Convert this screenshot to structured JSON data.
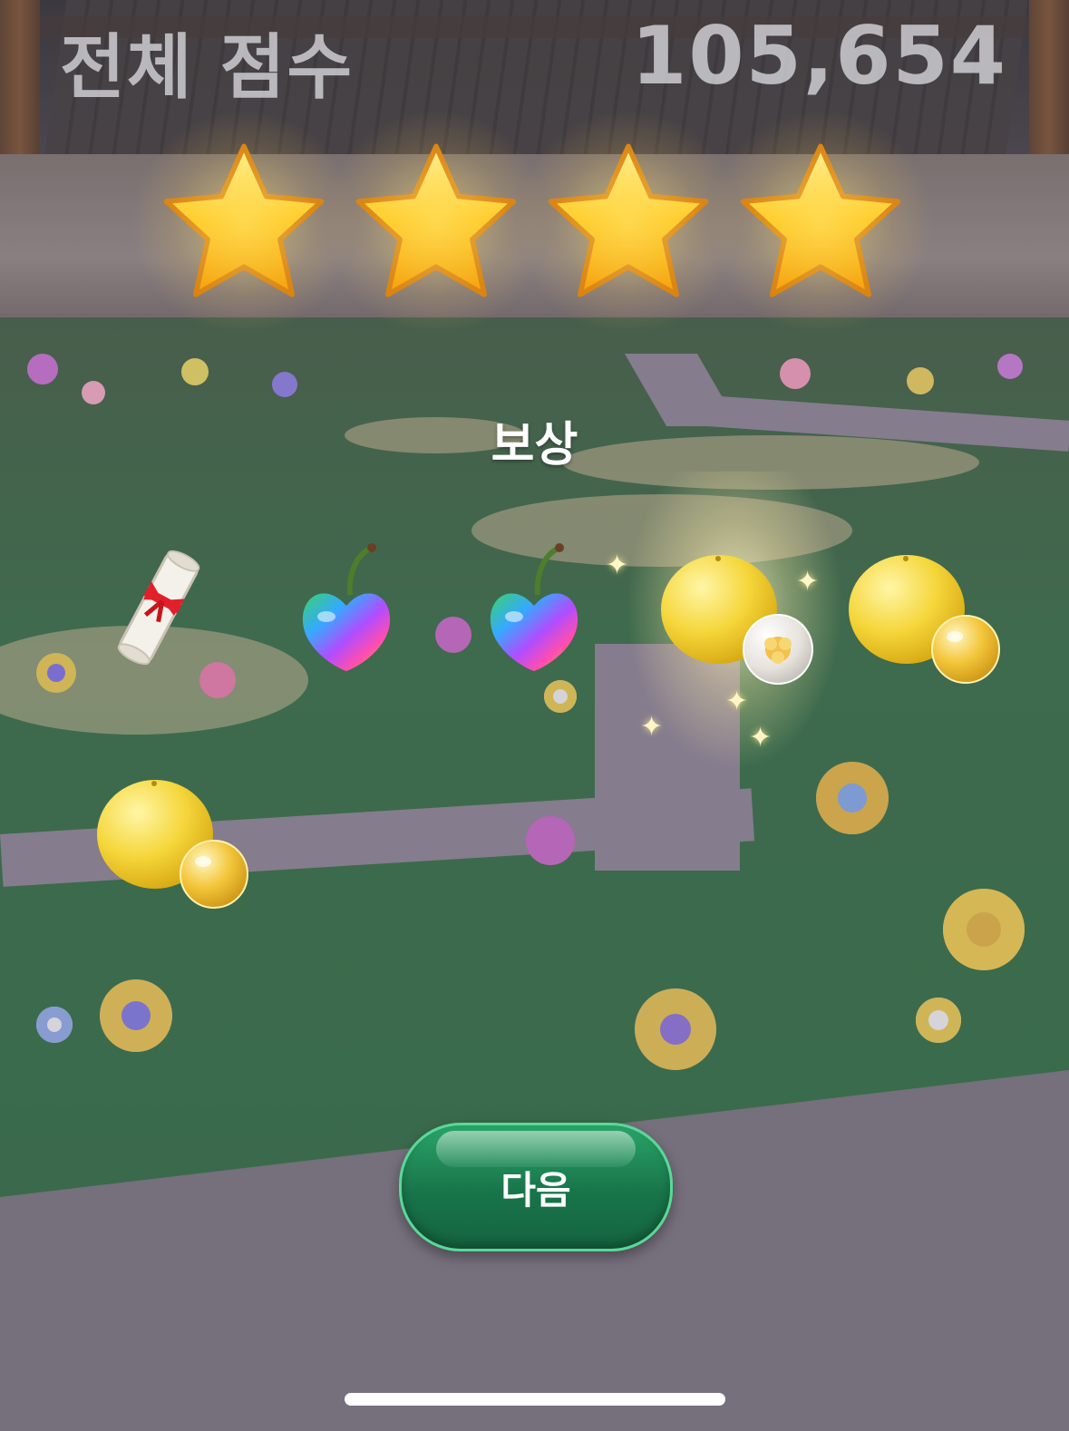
{
  "hud": {
    "total_score_label": "전체 점수",
    "total_score_value": "105,654"
  },
  "result": {
    "stars_earned": 4,
    "stars_total": 4
  },
  "rewards": {
    "title": "보상",
    "items": [
      {
        "icon": "scroll-icon"
      },
      {
        "icon": "rainbow-cherry-icon"
      },
      {
        "icon": "rainbow-cherry-icon"
      },
      {
        "icon": "yuzu-flower-bubble-icon",
        "highlighted": true
      },
      {
        "icon": "yuzu-bubble-icon"
      },
      {
        "icon": "yuzu-bubble-icon"
      }
    ]
  },
  "actions": {
    "next_label": "다음"
  },
  "colors": {
    "star_gold": "#ffcc1a",
    "button_green": "#1f8c57",
    "button_border": "#59d89a"
  }
}
